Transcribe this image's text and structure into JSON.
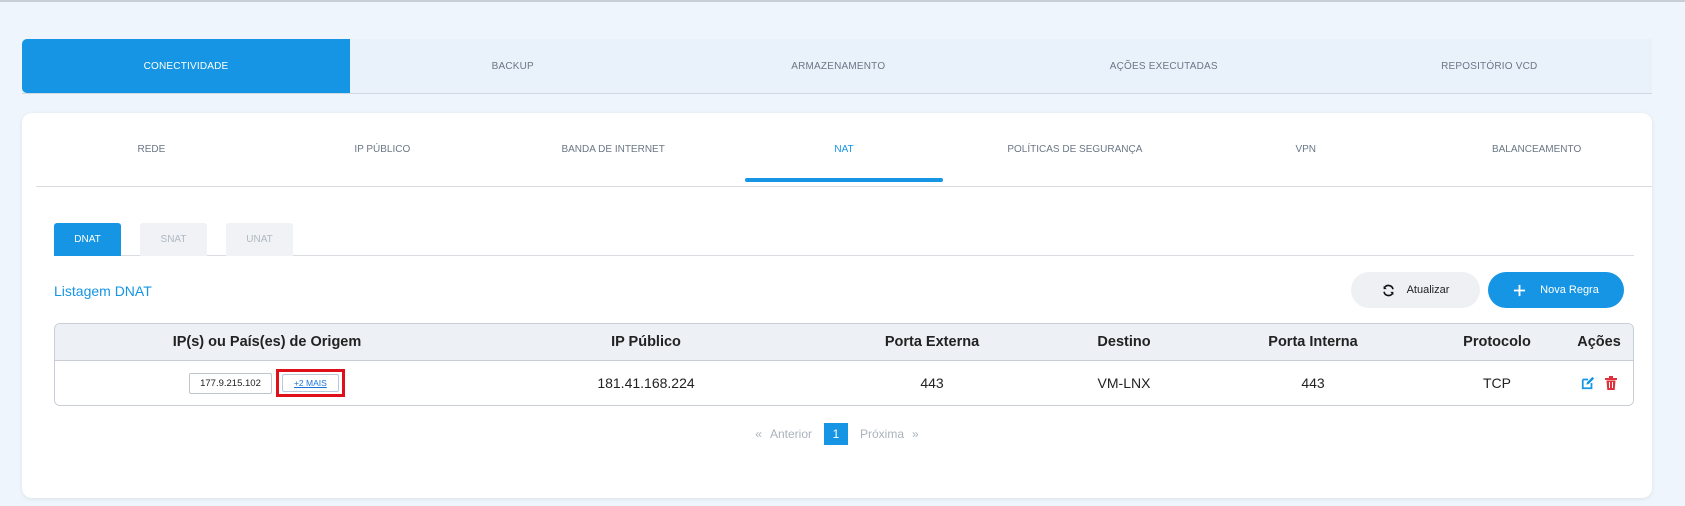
{
  "top_tabs": [
    "CONECTIVIDADE",
    "BACKUP",
    "ARMAZENAMENTO",
    "AÇÕES EXECUTADAS",
    "REPOSITÓRIO VCD"
  ],
  "sub_tabs": [
    "REDE",
    "IP PÚBLICO",
    "BANDA DE INTERNET",
    "NAT",
    "POLÍTICAS DE SEGURANÇA",
    "VPN",
    "BALANCEAMENTO"
  ],
  "nat_tabs": [
    "DNAT",
    "SNAT",
    "UNAT"
  ],
  "list_title": "Listagem DNAT",
  "buttons": {
    "refresh": "Atualizar",
    "new_rule": "Nova Regra"
  },
  "table": {
    "headers": [
      "IP(s) ou País(es) de Origem",
      "IP Público",
      "Porta Externa",
      "Destino",
      "Porta Interna",
      "Protocolo",
      "Ações"
    ],
    "rows": [
      {
        "origin_ip": "177.9.215.102",
        "more": "+2 MAIS",
        "public_ip": "181.41.168.224",
        "external_port": "443",
        "destination": "VM-LNX",
        "internal_port": "443",
        "protocol": "TCP"
      }
    ]
  },
  "pagination": {
    "prev_arrow": "«",
    "prev": "Anterior",
    "current": "1",
    "next": "Próxima",
    "next_arrow": "»"
  },
  "icons": [
    "refresh-icon",
    "plus-icon",
    "edit-icon",
    "trash-icon"
  ],
  "colors": {
    "accent": "#1595e3",
    "delete": "#e0303a",
    "highlight": "#e0101a"
  }
}
